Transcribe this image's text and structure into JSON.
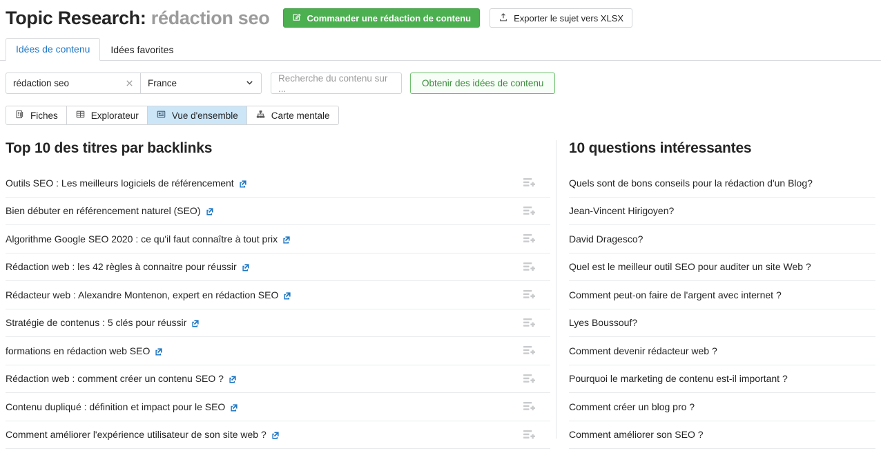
{
  "header": {
    "title_prefix": "Topic Research:",
    "keyword": "rédaction seo",
    "order_button": "Commander une rédaction de contenu",
    "export_button": "Exporter le sujet vers XLSX",
    "order_icon": "compose-icon",
    "export_icon": "upload-icon"
  },
  "tabs": [
    {
      "label": "Idées de contenu",
      "active": true
    },
    {
      "label": "Idées favorites",
      "active": false
    }
  ],
  "search": {
    "keyword_value": "rédaction seo",
    "keyword_clear_icon": "close-icon",
    "country_value": "France",
    "country_caret_icon": "chevron-down-icon",
    "domain_placeholder": "Recherche du contenu sur ...",
    "domain_value": "",
    "submit_label": "Obtenir des idées de contenu"
  },
  "views": [
    {
      "label": "Fiches",
      "icon": "cards-icon",
      "active": false
    },
    {
      "label": "Explorateur",
      "icon": "table-icon",
      "active": false
    },
    {
      "label": "Vue d'ensemble",
      "icon": "overview-icon",
      "active": true
    },
    {
      "label": "Carte mentale",
      "icon": "mindmap-icon",
      "active": false
    }
  ],
  "left_panel": {
    "title": "Top 10 des titres par backlinks",
    "row_action_icon": "add-to-list-icon",
    "link_icon": "external-link-icon",
    "items": [
      "Outils SEO : Les meilleurs logiciels de référencement",
      "Bien débuter en référencement naturel (SEO)",
      "Algorithme Google SEO 2020 : ce qu'il faut connaître à tout prix",
      "Rédaction web : les 42 règles à connaitre pour réussir",
      "Rédacteur web : Alexandre Montenon, expert en rédaction SEO",
      "Stratégie de contenus : 5 clés pour réussir",
      "formations en rédaction web SEO",
      "Rédaction web : comment créer un contenu SEO ?",
      "Contenu dupliqué : définition et impact pour le SEO",
      "Comment améliorer l'expérience utilisateur de son site web ?"
    ]
  },
  "right_panel": {
    "title": "10 questions intéressantes",
    "items": [
      "Quels sont de bons conseils pour la rédaction d'un Blog?",
      "Jean-Vincent Hirigoyen?",
      "David Dragesco?",
      "Quel est le meilleur outil SEO pour auditer un site Web ?",
      "Comment peut-on faire de l'argent avec internet ?",
      "Lyes Boussouf?",
      "Comment devenir rédacteur web ?",
      "Pourquoi le marketing de contenu est-il important ?",
      "Comment créer un blog pro ?",
      "Comment améliorer son SEO ?"
    ]
  },
  "colors": {
    "brand_green": "#4caf50",
    "link_blue": "#1f77c4",
    "active_tab_blue": "#cce6f8",
    "muted": "#9b9b9b",
    "border": "#d2d4d7"
  }
}
